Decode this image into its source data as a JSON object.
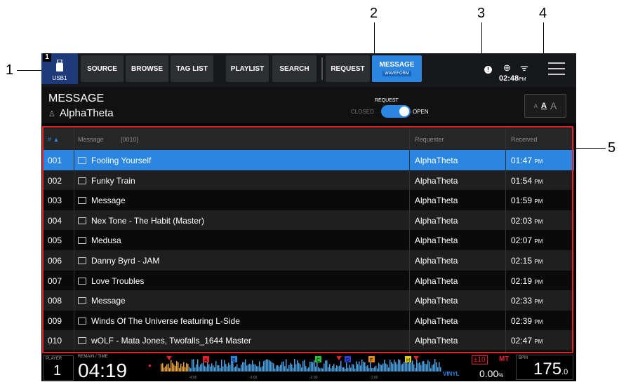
{
  "callouts": [
    "1",
    "2",
    "3",
    "4",
    "5"
  ],
  "topbar": {
    "device_number": "1",
    "device_label": "USB1",
    "buttons": [
      "SOURCE",
      "BROWSE",
      "TAG LIST",
      "PLAYLIST",
      "SEARCH",
      "REQUEST",
      "MESSAGE"
    ],
    "active_sublabel": "WAVEFORM",
    "warning_symbol": "!",
    "clock": "02:48",
    "clock_ampm": "PM"
  },
  "header": {
    "title": "MESSAGE",
    "user": "AlphaTheta",
    "request_label": "REQUEST",
    "closed_label": "CLOSED",
    "open_label": "OPEN",
    "toggle_on": true,
    "font_small": "A",
    "font_medium": "A",
    "font_large": "A"
  },
  "table": {
    "columns": {
      "number": "#",
      "message": "Message",
      "count": "[0010]",
      "requester": "Requester",
      "received": "Received"
    },
    "rows": [
      {
        "no": "001",
        "message": "Fooling Yourself",
        "requester": "AlphaTheta",
        "time": "01:47",
        "ampm": "PM",
        "heart": true
      },
      {
        "no": "002",
        "message": "Funky Train",
        "requester": "AlphaTheta",
        "time": "01:54",
        "ampm": "PM",
        "heart": false
      },
      {
        "no": "003",
        "message": "Message",
        "requester": "AlphaTheta",
        "time": "01:59",
        "ampm": "PM",
        "heart": false
      },
      {
        "no": "004",
        "message": "Nex Tone - The Habit (Master)",
        "requester": "AlphaTheta",
        "time": "02:03",
        "ampm": "PM",
        "heart": false
      },
      {
        "no": "005",
        "message": "Medusa",
        "requester": "AlphaTheta",
        "time": "02:07",
        "ampm": "PM",
        "heart": false
      },
      {
        "no": "006",
        "message": "Danny Byrd - JAM",
        "requester": "AlphaTheta",
        "time": "02:15",
        "ampm": "PM",
        "heart": true
      },
      {
        "no": "007",
        "message": "Love Troubles",
        "requester": "AlphaTheta",
        "time": "02:19",
        "ampm": "PM",
        "heart": false
      },
      {
        "no": "008",
        "message": "Message",
        "requester": "AlphaTheta",
        "time": "02:33",
        "ampm": "PM",
        "heart": false
      },
      {
        "no": "009",
        "message": "Winds Of The Universe featuring L-Side",
        "requester": "AlphaTheta",
        "time": "02:39",
        "ampm": "PM",
        "heart": true
      },
      {
        "no": "010",
        "message": "wOLF - Mata Jones, Twofalls_1644 Master",
        "requester": "AlphaTheta",
        "time": "02:47",
        "ampm": "PM",
        "heart": false
      }
    ]
  },
  "bottom": {
    "player_label": "PLAYER",
    "player_number": "1",
    "remain_label": "REMAIN / TIME",
    "time": "04:19",
    "hot_cues": [
      "A",
      "B",
      "C",
      "D",
      "F",
      "H"
    ],
    "ticks": [
      "-4:00",
      "-3:00",
      "-2:00",
      "-1:00"
    ],
    "vinyl": "VINYL",
    "pitch_range": "±10",
    "mt": "MT",
    "pitch_value": "0.00",
    "pitch_unit": "%",
    "bpm_label": "BPM",
    "bpm": "175",
    "bpm_decimal": ".0"
  },
  "colors": {
    "accent": "#2a86e0",
    "highlight_box": "#e0242c",
    "heart": "#e22233"
  }
}
